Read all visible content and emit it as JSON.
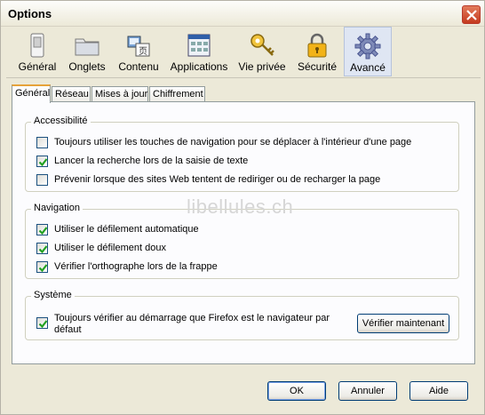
{
  "window": {
    "title": "Options"
  },
  "toolbar": {
    "panes": [
      {
        "label": "Général",
        "icon": "general-icon"
      },
      {
        "label": "Onglets",
        "icon": "folder-tabs-icon"
      },
      {
        "label": "Contenu",
        "icon": "content-icon"
      },
      {
        "label": "Applications",
        "icon": "applications-icon"
      },
      {
        "label": "Vie privée",
        "icon": "privacy-key-icon"
      },
      {
        "label": "Sécurité",
        "icon": "padlock-icon"
      },
      {
        "label": "Avancé",
        "icon": "gear-icon",
        "selected": true
      }
    ]
  },
  "tabs": [
    "Général",
    "Réseau",
    "Mises à jour",
    "Chiffrement"
  ],
  "groups": {
    "accessibility": {
      "title": "Accessibilité",
      "items": [
        {
          "label": "Toujours utiliser les touches de navigation pour se déplacer à l'intérieur d'une page",
          "checked": false
        },
        {
          "label": "Lancer la recherche lors de la saisie de texte",
          "checked": true
        },
        {
          "label": "Prévenir lorsque des sites Web tentent de rediriger ou de recharger la page",
          "checked": false
        }
      ]
    },
    "navigation": {
      "title": "Navigation",
      "items": [
        {
          "label": "Utiliser le défilement automatique",
          "checked": true
        },
        {
          "label": "Utiliser le défilement doux",
          "checked": true
        },
        {
          "label": "Vérifier l'orthographe lors de la frappe",
          "checked": true
        }
      ]
    },
    "system": {
      "title": "Système",
      "item": {
        "label_line1": "Toujours vérifier au démarrage que Firefox est le navigateur par",
        "label_line2": "défaut",
        "checked": true
      },
      "check_now_label": "Vérifier maintenant"
    }
  },
  "watermark": "libellules.ch",
  "footer": {
    "ok_label": "OK",
    "cancel_label": "Annuler",
    "help_label": "Aide"
  },
  "colors": {
    "accent_tab": "#e6a23a",
    "selected_pane": "#dfe6f3",
    "checkmark": "#21a121"
  }
}
